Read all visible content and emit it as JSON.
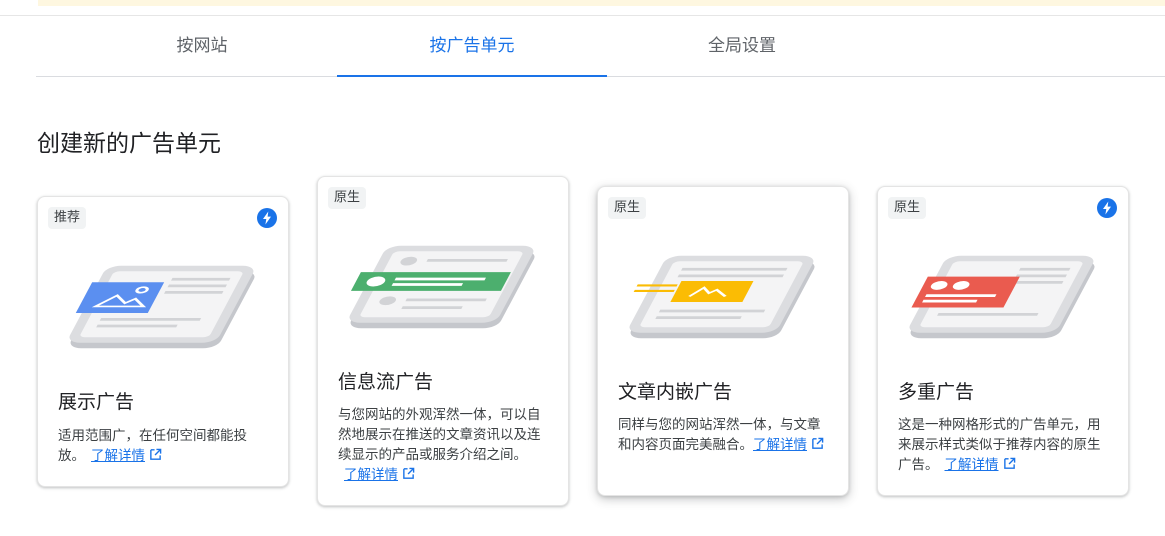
{
  "tabs": [
    {
      "label": "按网站"
    },
    {
      "label": "按广告单元",
      "active": true
    },
    {
      "label": "全局设置"
    }
  ],
  "section_title": "创建新的广告单元",
  "cards": [
    {
      "badge": "推荐",
      "title": "展示广告",
      "description": "适用范围广，在任何空间都能投放。",
      "learn_more": "了解详情",
      "has_bolt": true,
      "accent": "#5b8ff0"
    },
    {
      "badge": "原生",
      "title": "信息流广告",
      "description": "与您网站的外观浑然一体，可以自然地展示在推送的文章资讯以及连续显示的产品或服务介绍之间。",
      "learn_more": "了解详情",
      "has_bolt": false,
      "accent": "#4caf6e"
    },
    {
      "badge": "原生",
      "title": "文章内嵌广告",
      "description": "同样与您的网站浑然一体，与文章和内容页面完美融合。",
      "learn_more": "了解详情",
      "has_bolt": false,
      "accent": "#fbbc04"
    },
    {
      "badge": "原生",
      "title": "多重广告",
      "description": "这是一种网格形式的广告单元，用来展示样式类似于推荐内容的原生广告。",
      "learn_more": "了解详情",
      "has_bolt": true,
      "accent": "#ea5b4f"
    }
  ],
  "colors": {
    "primary": "#1a73e8",
    "phone_gray": "#dcdde0"
  }
}
